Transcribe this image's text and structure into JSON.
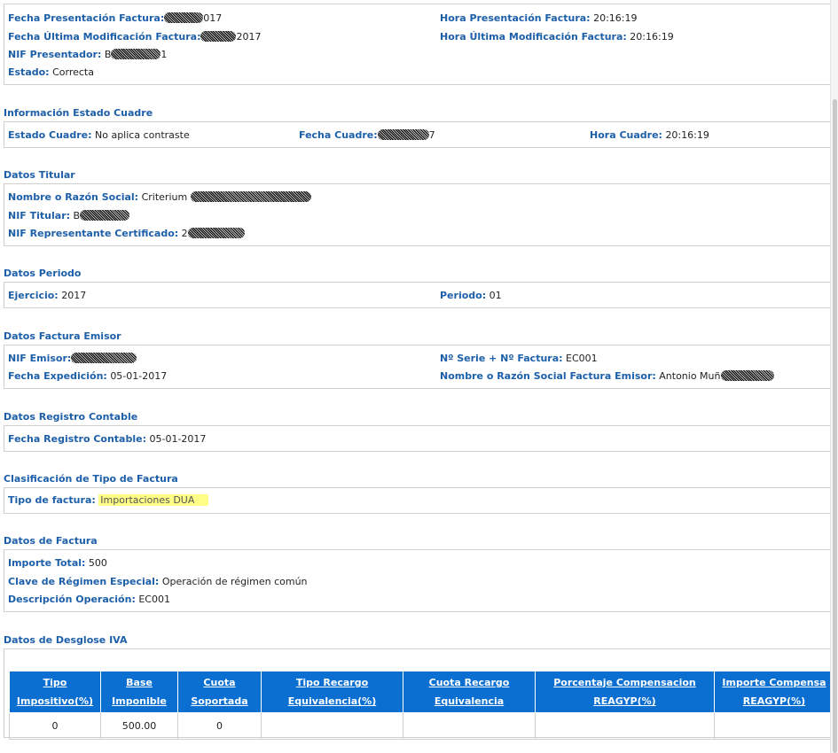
{
  "presentacion": {
    "fecha_label": "Fecha Presentación Factura:",
    "fecha_value": "017",
    "hora_label": "Hora Presentación Factura:",
    "hora_value": "20:16:19",
    "fecha_mod_label": "Fecha Última Modificación Factura:",
    "fecha_mod_value": "2017",
    "hora_mod_label": "Hora Última Modificación Factura:",
    "hora_mod_value": "20:16:19",
    "nif_label": "NIF Presentador:",
    "nif_prefix": "B",
    "nif_suffix": "1",
    "estado_label": "Estado:",
    "estado_value": "Correcta"
  },
  "cuadre": {
    "title": "Información Estado Cuadre",
    "estado_label": "Estado Cuadre:",
    "estado_value": "No aplica contraste",
    "fecha_label": "Fecha Cuadre:",
    "fecha_value": "7",
    "hora_label": "Hora Cuadre:",
    "hora_value": "20:16:19"
  },
  "titular": {
    "title": "Datos Titular",
    "nombre_label": "Nombre o Razón Social:",
    "nombre_value": "Criterium",
    "nif_label": "NIF Titular:",
    "nif_value": "B",
    "nif_rep_label": "NIF Representante Certificado:",
    "nif_rep_value": "2"
  },
  "periodo": {
    "title": "Datos Periodo",
    "ejercicio_label": "Ejercicio:",
    "ejercicio_value": "2017",
    "periodo_label": "Periodo:",
    "periodo_value": "01"
  },
  "emisor": {
    "title": "Datos Factura Emisor",
    "nif_label": "NIF Emisor:",
    "serie_label": "Nº Serie + Nº Factura:",
    "serie_value": "EC001",
    "fecha_exp_label": "Fecha Expedición:",
    "fecha_exp_value": "05-01-2017",
    "nombre_label": "Nombre o Razón Social Factura Emisor:",
    "nombre_value": "Antonio Muñ"
  },
  "registro": {
    "title": "Datos Registro Contable",
    "fecha_label": "Fecha Registro Contable:",
    "fecha_value": "05-01-2017"
  },
  "clasificacion": {
    "title": "Clasificación de Tipo de Factura",
    "tipo_label": "Tipo de factura:",
    "tipo_value": "Importaciones DUA"
  },
  "factura": {
    "title": "Datos de Factura",
    "importe_label": "Importe Total:",
    "importe_value": "500",
    "clave_label": "Clave de Régimen Especial:",
    "clave_value": "Operación de régimen común",
    "desc_label": "Descripción Operación:",
    "desc_value": "EC001"
  },
  "desglose": {
    "title": "Datos de Desglose IVA",
    "headers": [
      [
        "Tipo",
        "Impositivo(%)"
      ],
      [
        "Base",
        "Imponible"
      ],
      [
        "Cuota",
        "Soportada"
      ],
      [
        "Tipo Recargo",
        "Equivalencia(%)"
      ],
      [
        "Cuota Recargo",
        "Equivalencia"
      ],
      [
        "Porcentaje Compensacion",
        "REAGYP(%)"
      ],
      [
        "Importe Compensa",
        "REAGYP(%)"
      ]
    ],
    "row": [
      "0",
      "500.00",
      "0",
      "",
      "",
      "",
      ""
    ]
  }
}
